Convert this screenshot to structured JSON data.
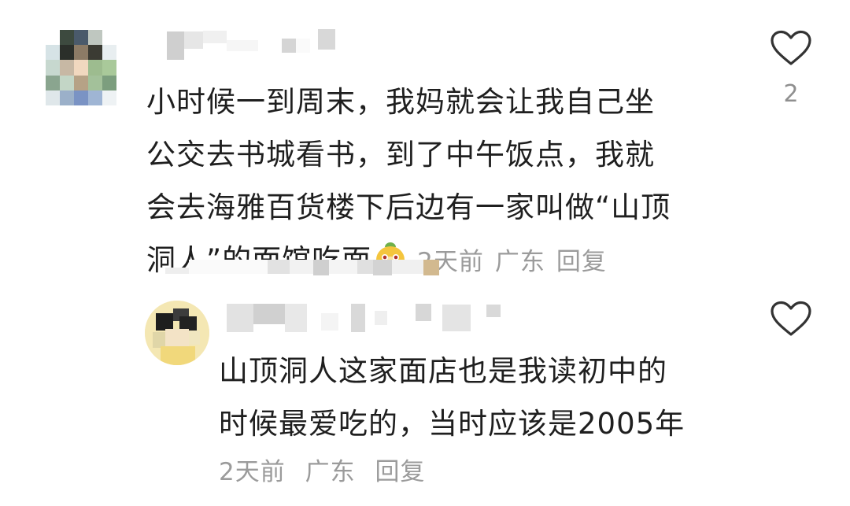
{
  "comment": {
    "text_lines": [
      "小时候一到周末，我妈就会让我自己坐",
      "公交去书城看书，到了中午饭点，我就",
      "会去海雅百货楼下后边有一家叫做“山顶",
      "洞人”的面馆吃面"
    ],
    "emoji": "dog-emoji",
    "time": "2天前",
    "location": "广东",
    "reply_label": "回复",
    "like_count": "2",
    "like_icon": "heart-outline-icon"
  },
  "reply": {
    "text_lines": [
      "山顶洞人这家面店也是我读初中的",
      "时候最爱吃的，当时应该是2005年"
    ],
    "time": "2天前",
    "location": "广东",
    "reply_label": "回复",
    "like_icon": "heart-outline-icon"
  },
  "colors": {
    "text": "#1f1f1f",
    "meta": "#9b9b9b",
    "icon": "#333333"
  }
}
